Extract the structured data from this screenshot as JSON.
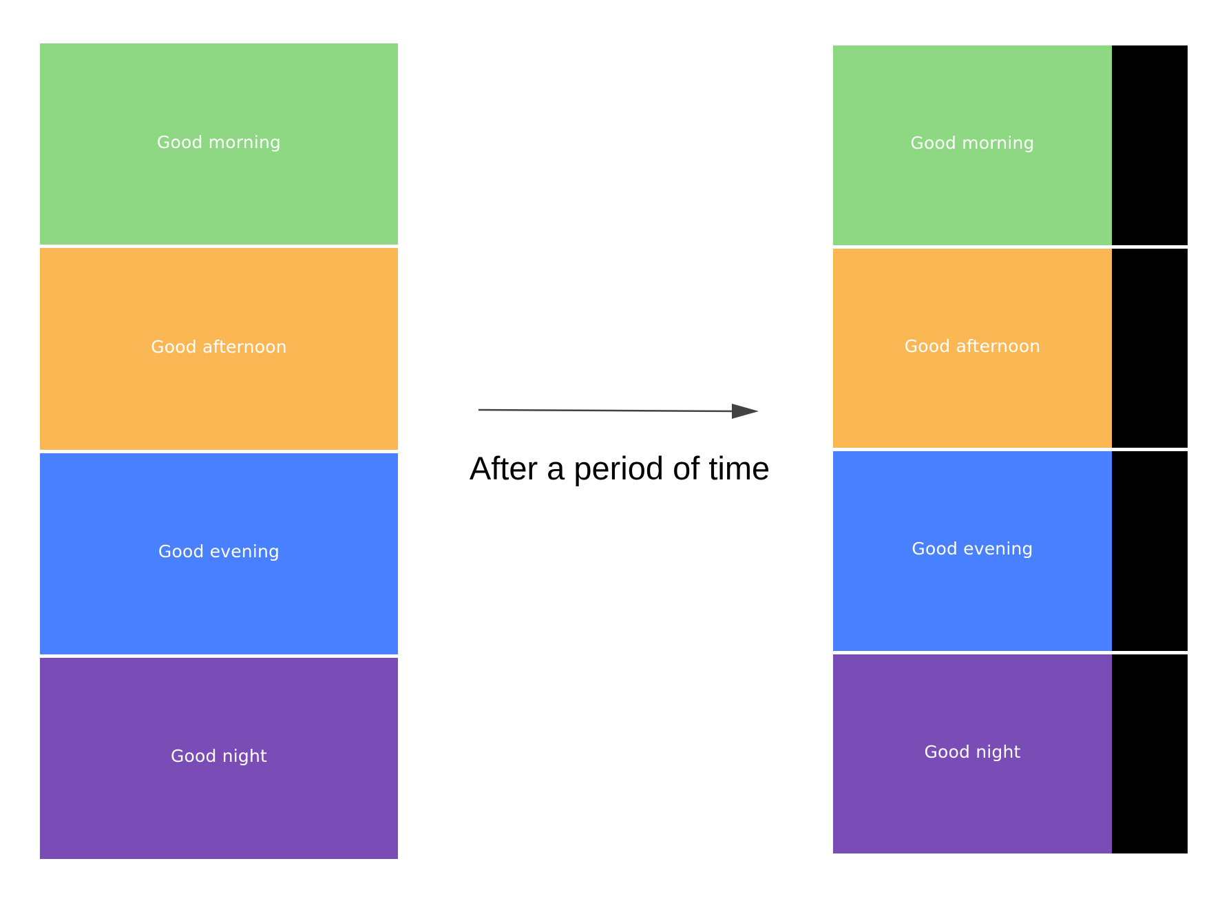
{
  "colors": {
    "morning": "#8ED783",
    "afternoon": "#FCB755",
    "evening": "#4880FF",
    "night": "#7A4CB5",
    "overlay": "#000000",
    "arrow": "#424242"
  },
  "before": {
    "blocks": [
      {
        "label": "Good morning",
        "color_key": "morning"
      },
      {
        "label": "Good afternoon",
        "color_key": "afternoon"
      },
      {
        "label": "Good evening",
        "color_key": "evening"
      },
      {
        "label": "Good night",
        "color_key": "night"
      }
    ]
  },
  "after": {
    "blocks": [
      {
        "label": "Good morning",
        "color_key": "morning"
      },
      {
        "label": "Good afternoon",
        "color_key": "afternoon"
      },
      {
        "label": "Good evening",
        "color_key": "evening"
      },
      {
        "label": "Good night",
        "color_key": "night"
      }
    ]
  },
  "transition": {
    "caption": "After a period of time"
  }
}
